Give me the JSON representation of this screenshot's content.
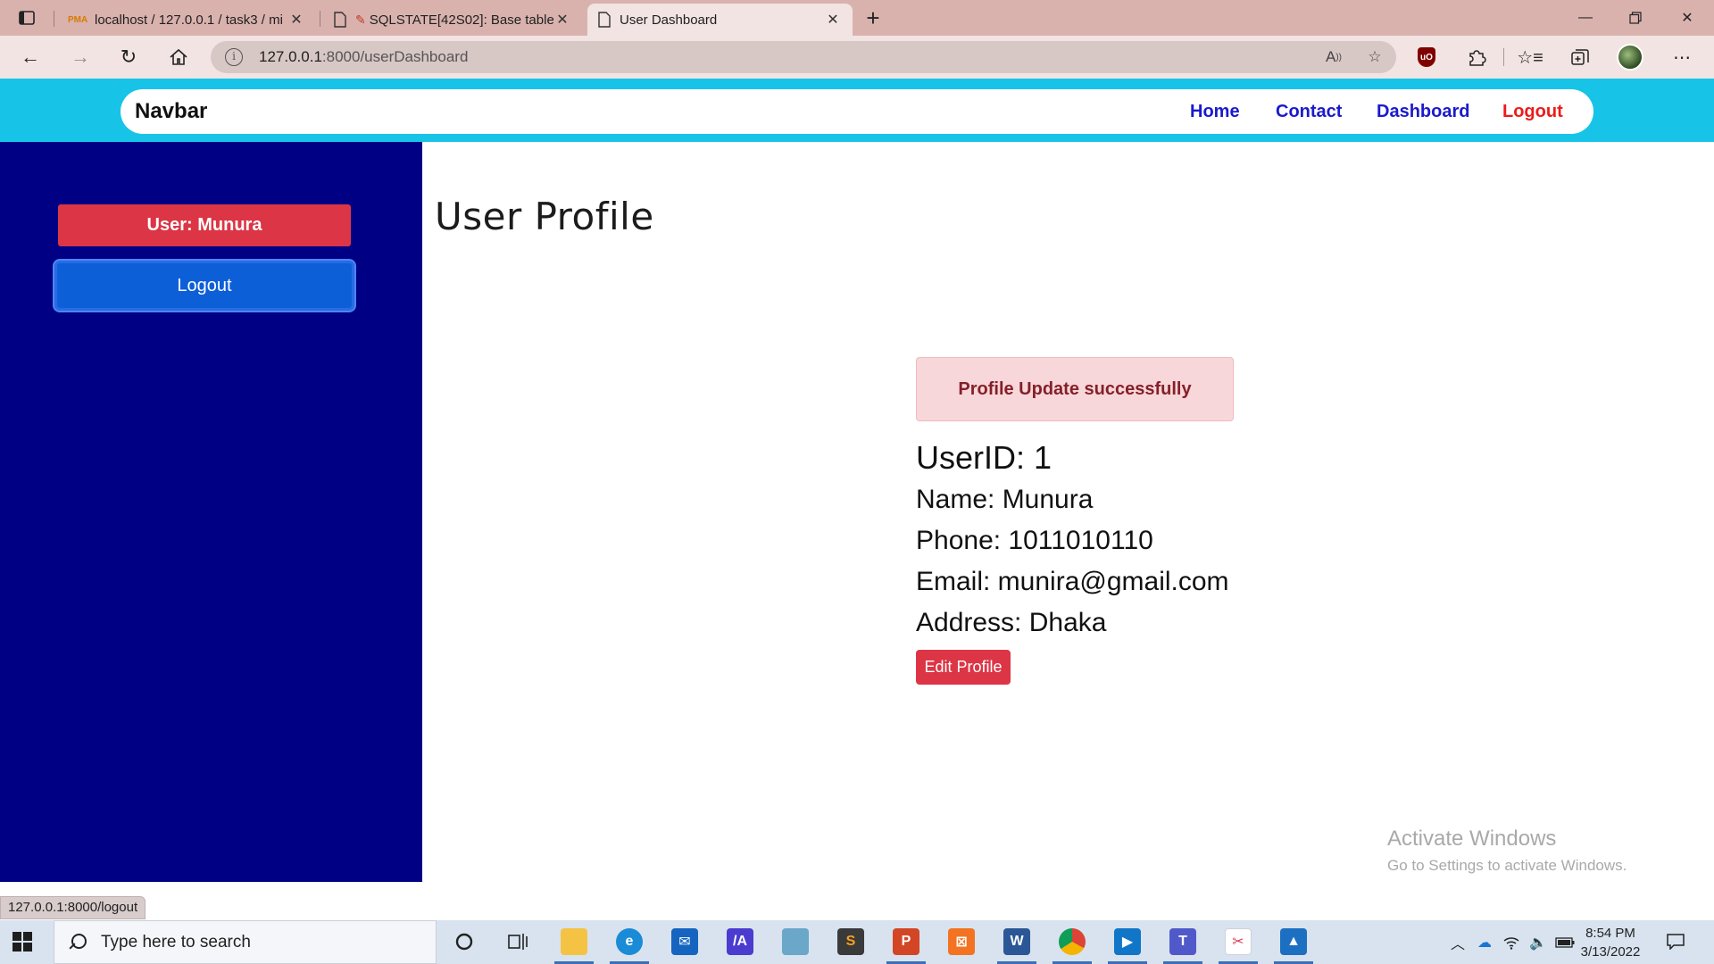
{
  "browser": {
    "tabs": [
      {
        "title": "localhost / 127.0.0.1 / task3 / mi",
        "favicon": "phpmyadmin-icon",
        "active": false
      },
      {
        "title": "SQLSTATE[42S02]: Base table",
        "favicon": "document-icon",
        "active": false
      },
      {
        "title": "User Dashboard",
        "favicon": "document-icon",
        "active": true
      }
    ],
    "address": {
      "host": "127.0.0.1",
      "path": ":8000/userDashboard"
    },
    "status_url": "127.0.0.1:8000/logout"
  },
  "navbar": {
    "brand": "Navbar",
    "links": [
      "Home",
      "Contact",
      "Dashboard",
      "Logout"
    ]
  },
  "sidebar": {
    "user_badge": "User: Munura",
    "logout_label": "Logout"
  },
  "main": {
    "title": "User Profile",
    "alert": "Profile Update successfully",
    "profile": {
      "userid": "UserID: 1",
      "name": "Name: Munura",
      "phone": "Phone: 1011010110",
      "email": "Email: munira@gmail.com",
      "address": "Address: Dhaka"
    },
    "edit_label": "Edit Profile"
  },
  "watermark": {
    "title": "Activate Windows",
    "subtitle": "Go to Settings to activate Windows."
  },
  "taskbar": {
    "search_placeholder": "Type here to search",
    "time": "8:54 PM",
    "date": "3/13/2022"
  },
  "colors": {
    "navbar_bg": "#17c4e8",
    "sidebar_bg": "#000085",
    "danger": "#dc3545",
    "primary": "#0d5fd8",
    "link": "#1a1acd",
    "alert_bg": "#f8d7da"
  }
}
